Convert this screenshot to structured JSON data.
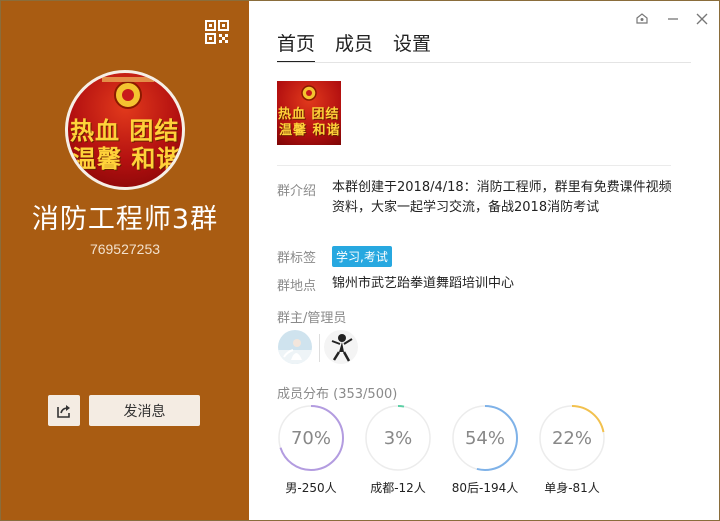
{
  "group": {
    "name": "消防工程师3群",
    "id": "769527253",
    "avatar_lines": [
      "热血 团结",
      "温馨 和谐"
    ]
  },
  "actions": {
    "share_icon": "share-icon",
    "send_label": "发消息"
  },
  "window_controls": [
    "skin-icon",
    "minimize-icon",
    "close-icon"
  ],
  "tabs": [
    {
      "label": "首页",
      "active": true
    },
    {
      "label": "成员",
      "active": false
    },
    {
      "label": "设置",
      "active": false
    }
  ],
  "info": {
    "intro_label": "群介绍",
    "intro_value": "本群创建于2018/4/18：消防工程师，群里有免费课件视频资料，大家一起学习交流，备战2018消防考试",
    "tag_label": "群标签",
    "tag_value": "学习,考试",
    "location_label": "群地点",
    "location_value": "锦州市武艺跆拳道舞蹈培训中心",
    "admins_label": "群主/管理员",
    "distribution_label": "成员分布",
    "distribution_count": "(353/500)"
  },
  "distribution": [
    {
      "pct_text": "70%",
      "value": 70,
      "caption": "男-250人",
      "color": "#b39ce0"
    },
    {
      "pct_text": "3%",
      "value": 3,
      "caption": "成都-12人",
      "color": "#5ccfa5"
    },
    {
      "pct_text": "54%",
      "value": 54,
      "caption": "80后-194人",
      "color": "#7fb2e8"
    },
    {
      "pct_text": "22%",
      "value": 22,
      "caption": "单身-81人",
      "color": "#f2c14e"
    }
  ],
  "colors": {
    "sidebar": "#a95c12",
    "tag": "#27a8e0"
  }
}
